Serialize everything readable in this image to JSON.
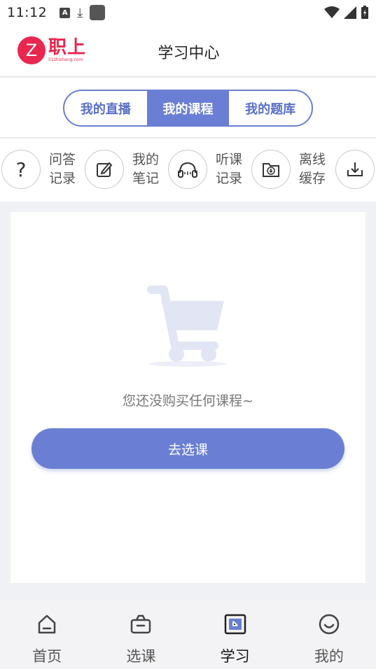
{
  "status_bar": {
    "time": "11:12"
  },
  "header": {
    "logo_letter": "Z",
    "logo_text": "职上",
    "logo_sub": "51zhishang.com",
    "title": "学习中心"
  },
  "tabs": [
    {
      "label": "我的直播",
      "active": false
    },
    {
      "label": "我的课程",
      "active": true
    },
    {
      "label": "我的题库",
      "active": false
    }
  ],
  "quick_actions": [
    {
      "line1": "问答",
      "line2": "记录",
      "icon": "question-icon"
    },
    {
      "line1": "我的",
      "line2": "笔记",
      "icon": "edit-note-icon"
    },
    {
      "line1": "听课",
      "line2": "记录",
      "icon": "headphones-icon"
    },
    {
      "line1": "离线",
      "line2": "缓存",
      "icon": "folder-download-icon"
    },
    {
      "icon": "download-icon"
    }
  ],
  "empty_state": {
    "icon": "cart-icon",
    "message": "您还没购买任何课程~",
    "button_label": "去选课"
  },
  "tabbar": [
    {
      "label": "首页",
      "icon": "home-icon",
      "active": false
    },
    {
      "label": "选课",
      "icon": "basket-icon",
      "active": false
    },
    {
      "label": "学习",
      "icon": "study-icon",
      "active": true
    },
    {
      "label": "我的",
      "icon": "smile-icon",
      "active": false
    }
  ],
  "colors": {
    "accent": "#6a7fd4",
    "brand": "#e9264e"
  }
}
